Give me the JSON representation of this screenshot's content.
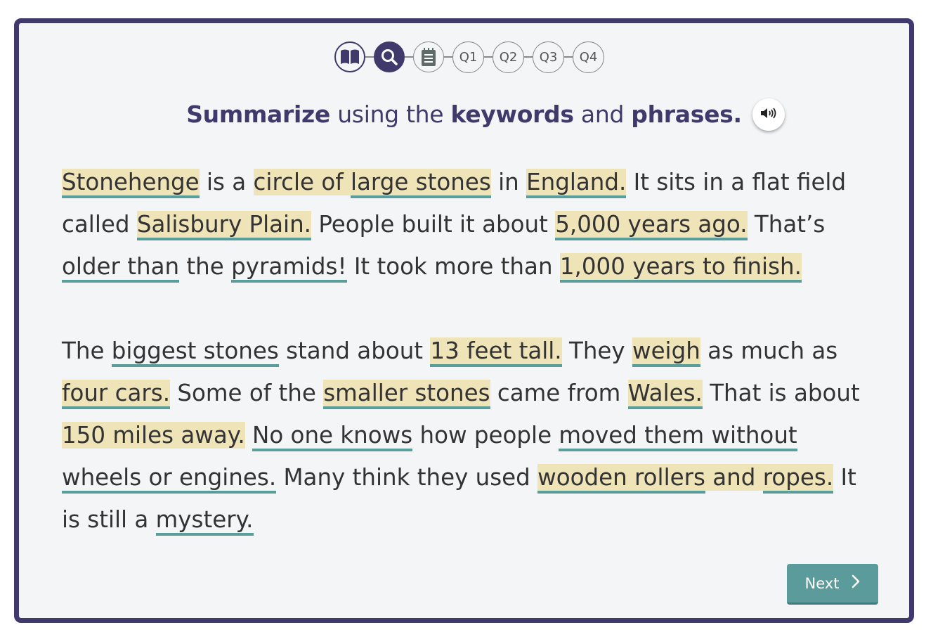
{
  "steps": {
    "icons": [
      "book-icon",
      "search-icon",
      "notes-icon"
    ],
    "labels": [
      "Q1",
      "Q2",
      "Q3",
      "Q4"
    ],
    "active": "search-icon"
  },
  "instruction": {
    "w1": "Summarize",
    "w2": " using the ",
    "w3": "keywords",
    "w4": " and ",
    "w5": "phrases."
  },
  "passage": {
    "p1": [
      {
        "t": "Stonehenge",
        "style": "hu"
      },
      {
        "t": " is a ",
        "style": ""
      },
      {
        "t": "circle of ",
        "style": "h"
      },
      {
        "t": "large stones",
        "style": "hu"
      },
      {
        "t": " in ",
        "style": ""
      },
      {
        "t": "England.",
        "style": "hu"
      },
      {
        "t": " It sits in a flat field called ",
        "style": ""
      },
      {
        "t": "Salisbury Plain.",
        "style": "hu"
      },
      {
        "t": " People built it about ",
        "style": ""
      },
      {
        "t": "5,000 years ago.",
        "style": "hu"
      },
      {
        "t": " That’s ",
        "style": ""
      },
      {
        "t": "older than",
        "style": "u"
      },
      {
        "t": " the ",
        "style": ""
      },
      {
        "t": "pyramids!",
        "style": "u"
      },
      {
        "t": " It took more than ",
        "style": ""
      },
      {
        "t": "1,000 years to finish.",
        "style": "hu"
      }
    ],
    "p2": [
      {
        "t": "The ",
        "style": ""
      },
      {
        "t": "biggest stones",
        "style": "u"
      },
      {
        "t": " stand about ",
        "style": ""
      },
      {
        "t": "13 feet tall.",
        "style": "hu"
      },
      {
        "t": " They ",
        "style": ""
      },
      {
        "t": "weigh",
        "style": "hu"
      },
      {
        "t": " as much as ",
        "style": ""
      },
      {
        "t": "four cars.",
        "style": "hu"
      },
      {
        "t": " Some of the ",
        "style": ""
      },
      {
        "t": "smaller stones",
        "style": "hu"
      },
      {
        "t": " came from ",
        "style": ""
      },
      {
        "t": "Wales.",
        "style": "hu"
      },
      {
        "t": " That is about ",
        "style": ""
      },
      {
        "t": "150 miles away.",
        "style": "h"
      },
      {
        "t": " ",
        "style": ""
      },
      {
        "t": "No one knows",
        "style": "u"
      },
      {
        "t": " how people ",
        "style": ""
      },
      {
        "t": "moved them without wheels or engines.",
        "style": "u"
      },
      {
        "t": " Many think they used ",
        "style": ""
      },
      {
        "t": "wooden rollers",
        "style": "hu"
      },
      {
        "t": " ",
        "style": "h"
      },
      {
        "t": "and ",
        "style": "h"
      },
      {
        "t": "ropes.",
        "style": "hu"
      },
      {
        "t": " It is still a ",
        "style": ""
      },
      {
        "t": "mystery.",
        "style": "u"
      }
    ]
  },
  "next_label": "Next",
  "colors": {
    "frame": "#3f3a6b",
    "highlight": "#efe3b8",
    "underline": "#5a9e9c",
    "button": "#5c9b9b"
  }
}
